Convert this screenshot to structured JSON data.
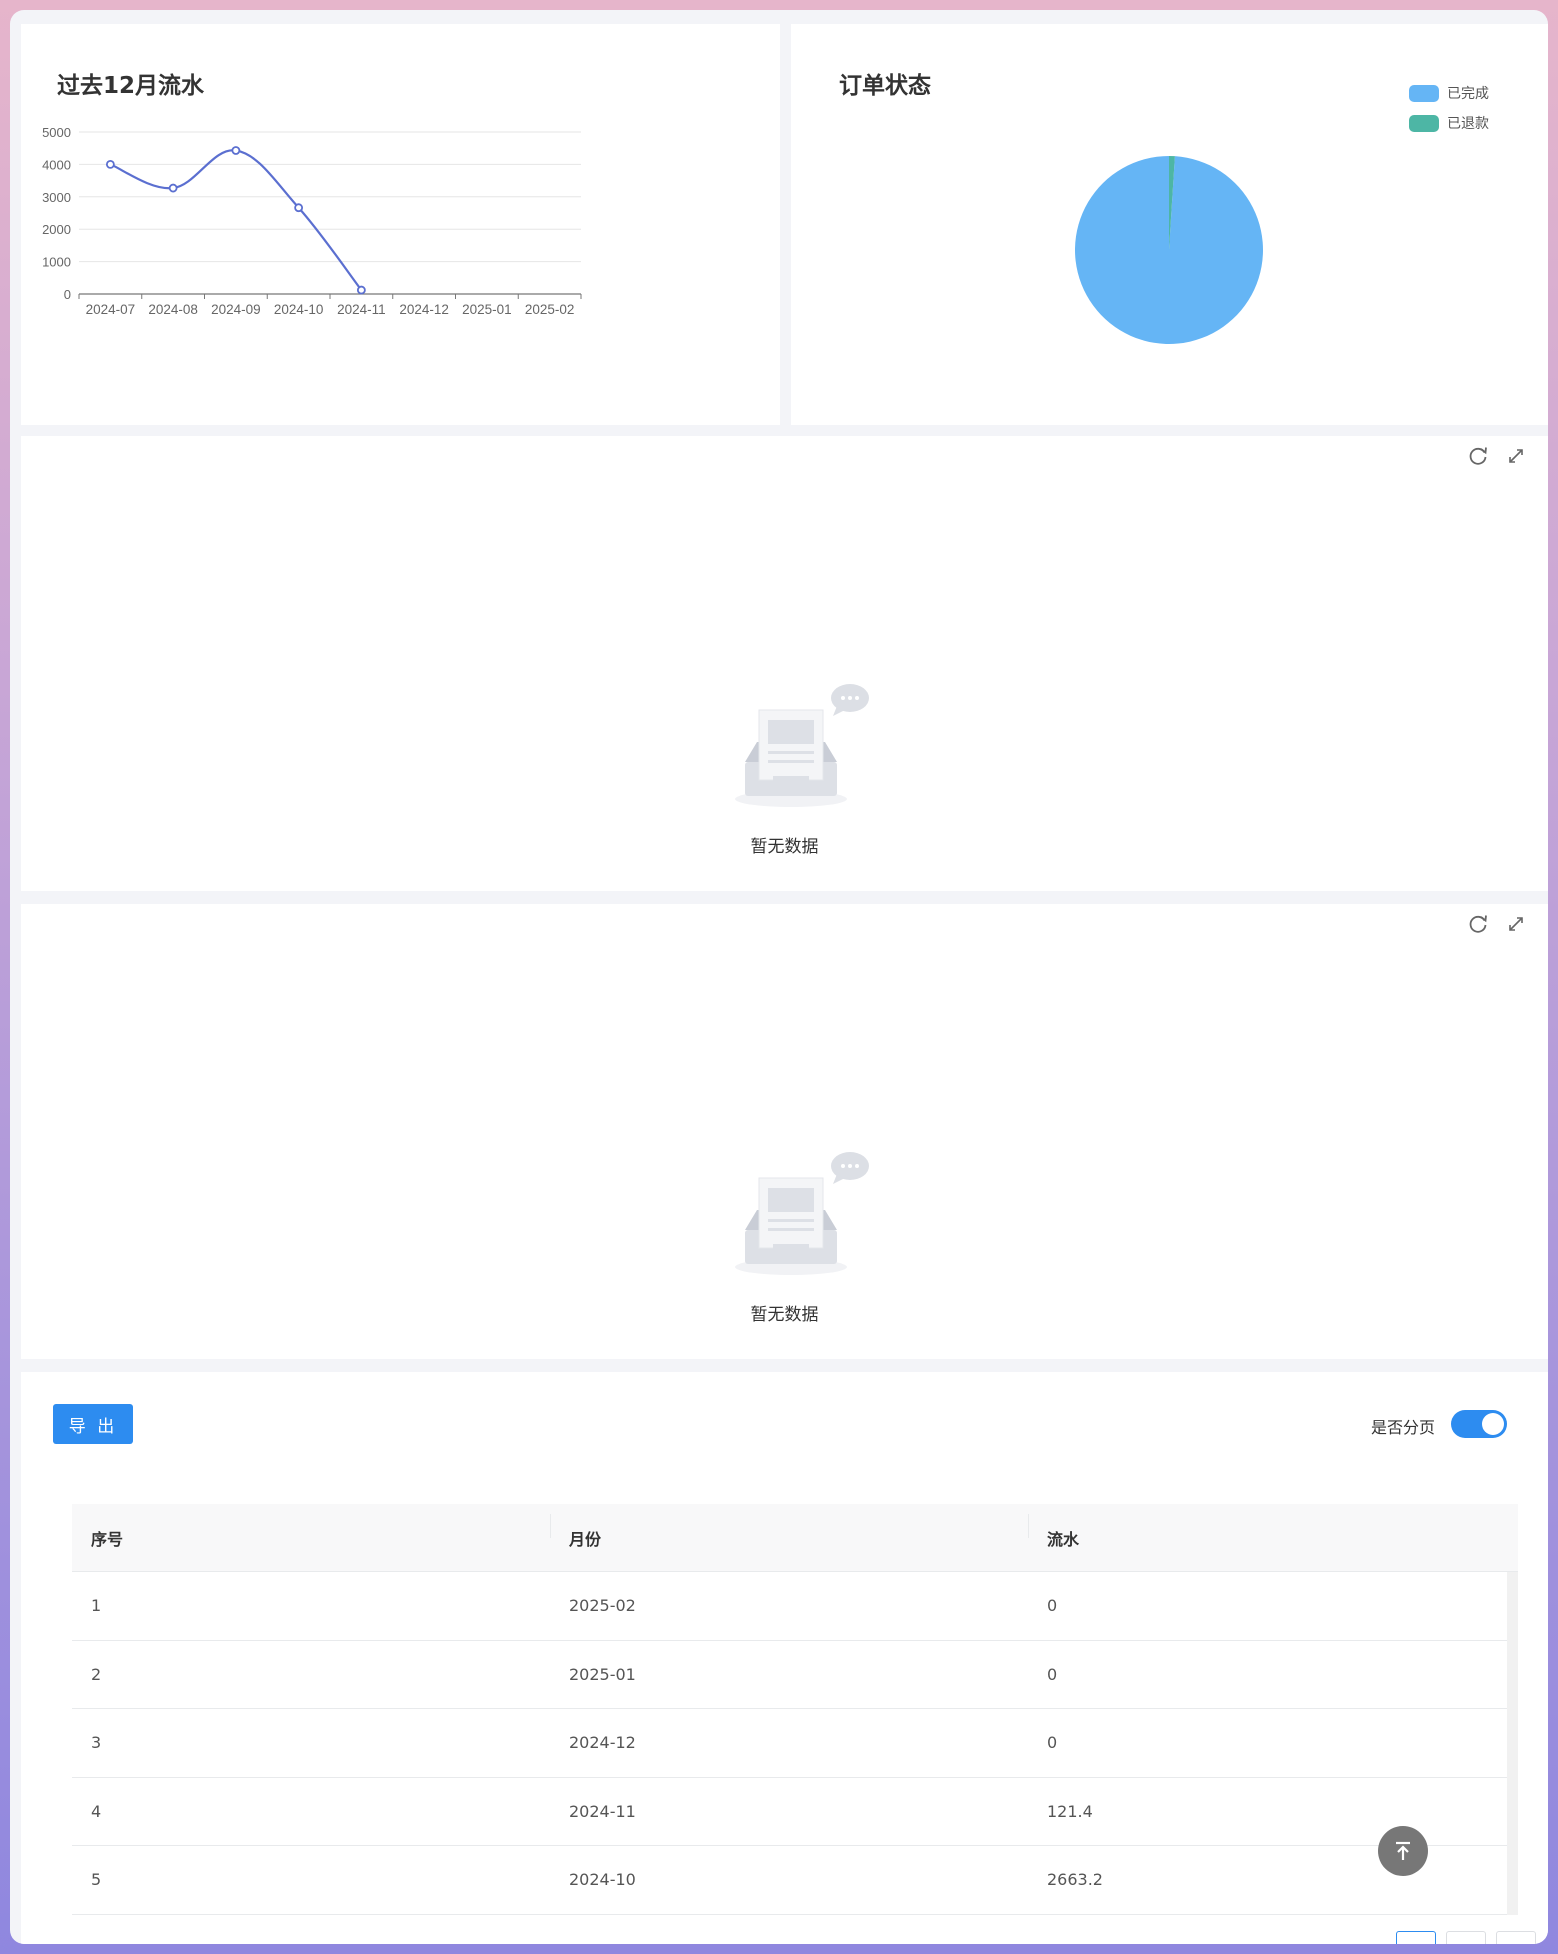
{
  "line_chart": {
    "title": "过去12月流水",
    "chart_data": {
      "type": "line",
      "categories": [
        "2024-07",
        "2024-08",
        "2024-09",
        "2024-10",
        "2024-11",
        "2024-12",
        "2025-01",
        "2025-02"
      ],
      "values": [
        4000,
        3270,
        4430,
        2663.2,
        121.4,
        null,
        null,
        null
      ],
      "y_ticks": [
        "0",
        "1000",
        "2000",
        "3000",
        "4000",
        "5000"
      ],
      "ylim": [
        0,
        5000
      ],
      "line_color": "#5b6fd0",
      "grid": true
    }
  },
  "pie_chart": {
    "title": "订单状态",
    "chart_data": {
      "type": "pie",
      "legend_position": "top-right",
      "slices": [
        {
          "label": "已完成",
          "value": 99,
          "color": "#65b5f5"
        },
        {
          "label": "已退款",
          "value": 1,
          "color": "#4db6a5"
        }
      ]
    }
  },
  "empty_panel_1": {
    "text": "暂无数据",
    "icons": [
      "refresh-icon",
      "expand-icon"
    ]
  },
  "empty_panel_2": {
    "text": "暂无数据",
    "icons": [
      "refresh-icon",
      "expand-icon"
    ]
  },
  "table_panel": {
    "export_label": "导 出",
    "paging_label": "是否分页",
    "paging_enabled": true,
    "accent_color": "#2d8cf0",
    "columns": [
      "序号",
      "月份",
      "流水"
    ],
    "rows": [
      [
        "1",
        "2025-02",
        "0"
      ],
      [
        "2",
        "2025-01",
        "0"
      ],
      [
        "3",
        "2024-12",
        "0"
      ],
      [
        "4",
        "2024-11",
        "121.4"
      ],
      [
        "5",
        "2024-10",
        "2663.2"
      ]
    ]
  },
  "back_to_top_icon": "arrow-up-to-top-icon"
}
